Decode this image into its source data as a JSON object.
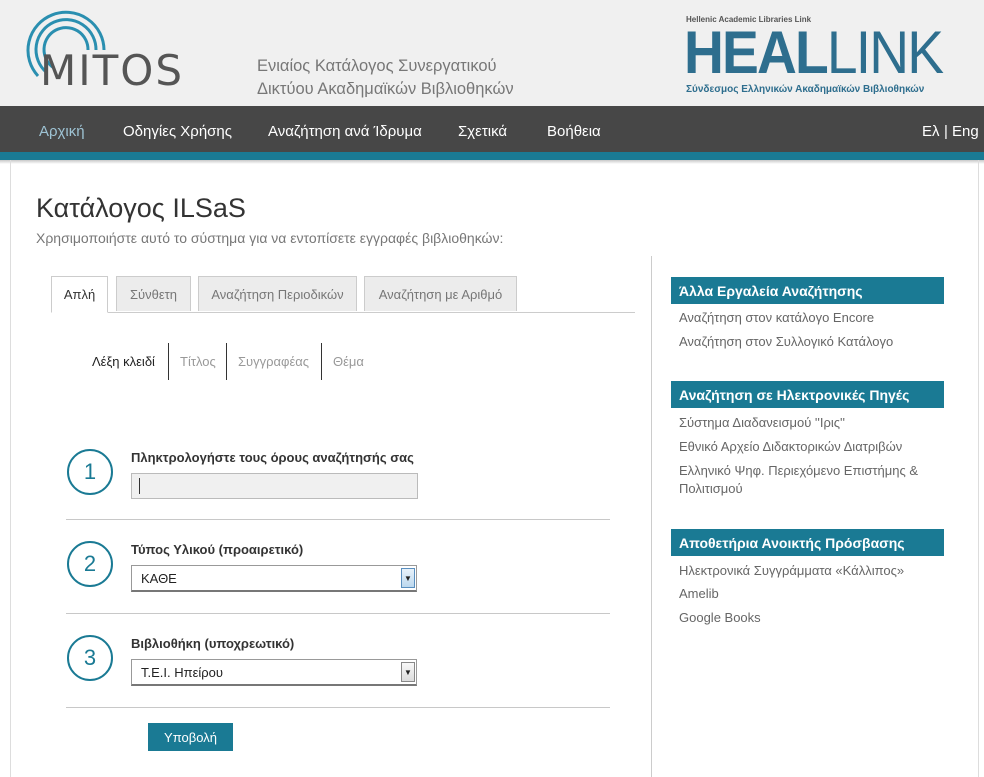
{
  "header": {
    "logo_text": "MITOS",
    "tagline_line1": "Ενιαίος Κατάλογος Συνεργατικού",
    "tagline_line2": "Δικτύου Ακαδημαϊκών Βιβλιοθηκών",
    "heallink_small": "Hellenic Academic Libraries Link",
    "heallink_heal": "HEAL",
    "heallink_link": "LINK",
    "heallink_sub": "Σύνδεσμος Ελληνικών Ακαδημαϊκών Βιβλιοθηκών"
  },
  "nav": {
    "items": [
      "Αρχική",
      "Οδηγίες Χρήσης",
      "Αναζήτηση ανά Ίδρυμα",
      "Σχετικά",
      "Βοήθεια"
    ],
    "lang_el": "Ελ",
    "lang_sep": "|",
    "lang_en": "Eng"
  },
  "main": {
    "title": "Κατάλογος ILSaS",
    "subtitle": "Χρησιμοποιήστε αυτό το σύστημα για να εντοπίσετε εγγραφές βιβλιοθηκών:",
    "tabs": [
      "Απλή",
      "Σύνθετη",
      "Αναζήτηση Περιοδικών",
      "Αναζήτηση με Αριθμό"
    ],
    "subtabs": [
      "Λέξη κλειδί",
      "Τίτλος",
      "Συγγραφέας",
      "Θέμα"
    ],
    "steps": [
      {
        "number": "1",
        "label": "Πληκτρολογήστε τους όρους αναζήτησής σας"
      },
      {
        "number": "2",
        "label": "Τύπος Υλικού (προαιρετικό)"
      },
      {
        "number": "3",
        "label": "Βιβλιοθήκη (υποχρεωτικό)"
      }
    ],
    "search_value": "",
    "material_selected": "ΚΑΘΕ",
    "library_selected": "Τ.Ε.Ι. Ηπείρου",
    "submit_label": "Υποβολή"
  },
  "sidebar": {
    "sections": [
      {
        "title": "Άλλα Εργαλεία Αναζήτησης",
        "links": [
          "Αναζήτηση στον κατάλογο Encore",
          "Αναζήτηση στον Συλλογικό Κατάλογο"
        ]
      },
      {
        "title": "Αναζήτηση σε Ηλεκτρονικές Πηγές",
        "links": [
          "Σύστημα Διαδανεισμού ''Ιρις''",
          "Εθνικό Αρχείο Διδακτορικών Διατριβών",
          "Ελληνικό Ψηφ. Περιεχόμενο Επιστήμης & Πολιτισμού"
        ]
      },
      {
        "title": "Αποθετήρια Ανοικτής Πρόσβασης",
        "links": [
          "Ηλεκτρονικά Συγγράμματα «Κάλλιπος»",
          "Amelib",
          "Google Books"
        ]
      }
    ]
  },
  "colors": {
    "accent": "#1a7a94",
    "nav_bg": "#474747",
    "header_bg": "#f0f0f0"
  }
}
